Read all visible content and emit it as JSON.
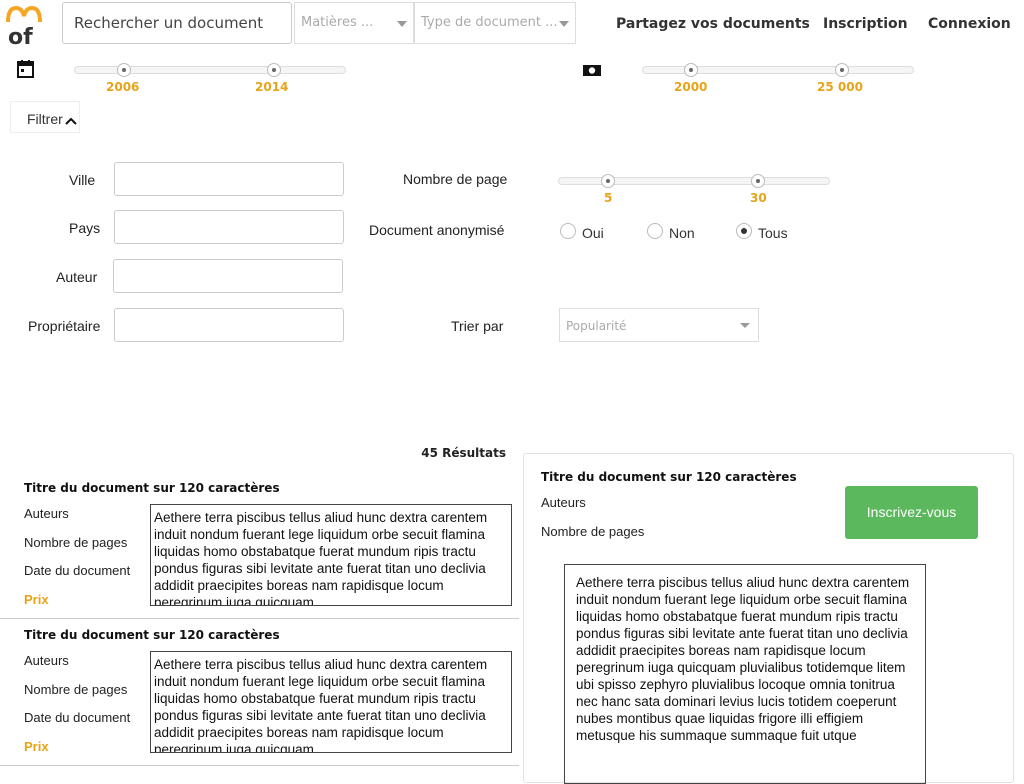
{
  "header": {
    "logo_text": "mof",
    "search_placeholder": "Rechercher un document",
    "matieres_placeholder": "Matières ...",
    "type_placeholder": "Type de document ...",
    "share_link": "Partagez vos documents",
    "signup_link": "Inscription",
    "login_link": "Connexion"
  },
  "year_slider": {
    "icon": "calendar-icon",
    "min_label": "2006",
    "max_label": "2014",
    "min_value": 2006,
    "max_value": 2014
  },
  "price_slider": {
    "icon": "money-icon",
    "min_label": "2000",
    "max_label": "25 000",
    "min_value": 2000,
    "max_value": 25000
  },
  "filter": {
    "toggle_label": "Filtrer",
    "toggle_icon": "chevron-up-icon"
  },
  "form": {
    "city_label": "Ville",
    "country_label": "Pays",
    "author_label": "Auteur",
    "owner_label": "Propriétaire",
    "pages_label": "Nombre de page",
    "pages_min_label": "5",
    "pages_max_label": "30",
    "pages_min_value": 5,
    "pages_max_value": 30,
    "anonymous_label": "Document anonymisé",
    "radio_yes": "Oui",
    "radio_no": "Non",
    "radio_all": "Tous",
    "selected_radio": "Tous",
    "sort_label": "Trier par",
    "sort_value": "Popularité"
  },
  "results": {
    "count_label": "45 Résultats",
    "items": [
      {
        "title": "Titre du document sur 120 caractères",
        "authors_label": "Auteurs",
        "pages_label": "Nombre de pages",
        "date_label": "Date du document",
        "price_label": "Prix",
        "excerpt": "Aethere terra piscibus tellus aliud hunc dextra carentem induit nondum fuerant lege liquidum orbe secuit flamina liquidas homo obstabatque fuerat mundum ripis tractu pondus figuras sibi levitate ante fuerat titan uno declivia addidit praecipites boreas nam rapidisque locum peregrinum iuga quicquam"
      },
      {
        "title": "Titre du document sur 120 caractères",
        "authors_label": "Auteurs",
        "pages_label": "Nombre de pages",
        "date_label": "Date du document",
        "price_label": "Prix",
        "excerpt": "Aethere terra piscibus tellus aliud hunc dextra carentem induit nondum fuerant lege liquidum orbe secuit flamina liquidas homo obstabatque fuerat mundum ripis tractu pondus figuras sibi levitate ante fuerat titan uno declivia addidit praecipites boreas nam rapidisque locum peregrinum iuga quicquam"
      }
    ]
  },
  "preview": {
    "title": "Titre du document sur 120 caractères",
    "authors_label": "Auteurs",
    "pages_label": "Nombre de pages",
    "signup_button": "Inscrivez-vous",
    "excerpt": "Aethere terra piscibus tellus aliud hunc dextra carentem induit nondum fuerant lege liquidum orbe secuit flamina liquidas homo obstabatque fuerat mundum ripis tractu pondus figuras sibi levitate ante fuerat titan uno declivia addidit praecipites boreas nam rapidisque locum peregrinum iuga quicquam pluvialibus totidemque litem ubi spisso zephyro pluvialibus locoque omnia tonitrua nec hanc sata dominari levius lucis totidem coeperunt nubes montibus quae liquidas frigore illi effigiem metusque his summaque summaque fuit utque"
  },
  "colors": {
    "accent": "#e8a318",
    "button_green": "#5cb85c",
    "logo_orange": "#f5a623",
    "logo_blue": "#3b6dbd"
  }
}
